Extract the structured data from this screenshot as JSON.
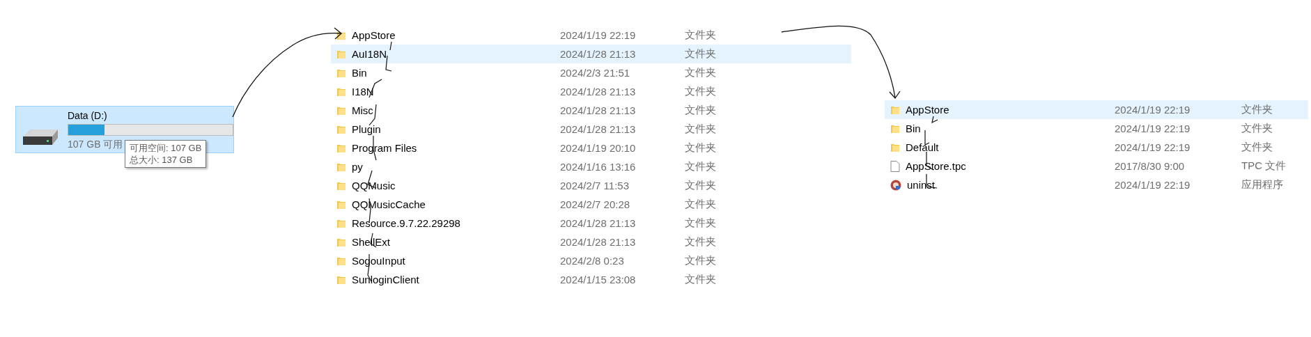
{
  "drive": {
    "name": "Data (D:)",
    "level": 0.22,
    "free_text": "107 GB 可用",
    "selected": true,
    "tooltip": [
      "可用空间: 107 GB",
      "总大小: 137 GB"
    ]
  },
  "folder_list": [
    {
      "kind": "folder",
      "name": "AppStore",
      "date": "2024/1/19 22:19",
      "type": "文件夹",
      "selected": false
    },
    {
      "kind": "folder",
      "name": "AuI18N",
      "date": "2024/1/28 21:13",
      "type": "文件夹",
      "selected": true
    },
    {
      "kind": "folder",
      "name": "Bin",
      "date": "2024/2/3 21:51",
      "type": "文件夹",
      "selected": false
    },
    {
      "kind": "folder",
      "name": "I18N",
      "date": "2024/1/28 21:13",
      "type": "文件夹",
      "selected": false
    },
    {
      "kind": "folder",
      "name": "Misc",
      "date": "2024/1/28 21:13",
      "type": "文件夹",
      "selected": false
    },
    {
      "kind": "folder",
      "name": "Plugin",
      "date": "2024/1/28 21:13",
      "type": "文件夹",
      "selected": false
    },
    {
      "kind": "folder",
      "name": "Program Files",
      "date": "2024/1/19 20:10",
      "type": "文件夹",
      "selected": false
    },
    {
      "kind": "folder",
      "name": "py",
      "date": "2024/1/16 13:16",
      "type": "文件夹",
      "selected": false
    },
    {
      "kind": "folder",
      "name": "QQMusic",
      "date": "2024/2/7 11:53",
      "type": "文件夹",
      "selected": false
    },
    {
      "kind": "folder",
      "name": "QQMusicCache",
      "date": "2024/2/7 20:28",
      "type": "文件夹",
      "selected": false
    },
    {
      "kind": "folder",
      "name": "Resource.9.7.22.29298",
      "date": "2024/1/28 21:13",
      "type": "文件夹",
      "selected": false
    },
    {
      "kind": "folder",
      "name": "ShellExt",
      "date": "2024/1/28 21:13",
      "type": "文件夹",
      "selected": false
    },
    {
      "kind": "folder",
      "name": "SogouInput",
      "date": "2024/2/8 0:23",
      "type": "文件夹",
      "selected": false
    },
    {
      "kind": "folder",
      "name": "SunloginClient",
      "date": "2024/1/15 23:08",
      "type": "文件夹",
      "selected": false
    }
  ],
  "sub_list": [
    {
      "kind": "folder",
      "name": "AppStore",
      "date": "2024/1/19 22:19",
      "type": "文件夹",
      "selected": true
    },
    {
      "kind": "folder",
      "name": "Bin",
      "date": "2024/1/19 22:19",
      "type": "文件夹",
      "selected": false
    },
    {
      "kind": "folder",
      "name": "Default",
      "date": "2024/1/19 22:19",
      "type": "文件夹",
      "selected": false
    },
    {
      "kind": "file",
      "name": "AppStore.tpc",
      "date": "2017/8/30 9:00",
      "type": "TPC 文件",
      "selected": false
    },
    {
      "kind": "app",
      "name": "uninst",
      "date": "2024/1/19 22:19",
      "type": "应用程序",
      "selected": false
    }
  ]
}
